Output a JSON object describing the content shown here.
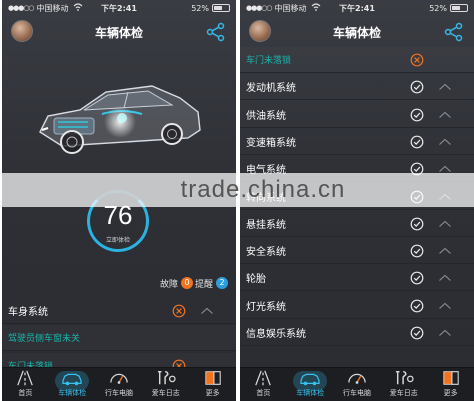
{
  "status": {
    "signal": "●●●○○",
    "carrier": "中国移动",
    "time": "下午2:41",
    "battery": "52%"
  },
  "header": {
    "title": "车辆体检"
  },
  "left": {
    "score": "76",
    "score_caption": "立即体检",
    "legend": {
      "fault_label": "故障",
      "fault_count": "0",
      "remind_label": "提醒",
      "remind_count": "2"
    },
    "rows": [
      {
        "label": "车身系统",
        "status": "error",
        "expanded": true
      },
      {
        "label": "驾驶员侧车窗未关",
        "status": "",
        "sub": true
      },
      {
        "label": "车门未落锁",
        "status": "error",
        "sub": true
      }
    ]
  },
  "right": {
    "rows": [
      {
        "label": "车门未落锁",
        "status": "error",
        "sub": true
      },
      {
        "label": "发动机系统",
        "status": "ok"
      },
      {
        "label": "供油系统",
        "status": "ok"
      },
      {
        "label": "变速箱系统",
        "status": "ok"
      },
      {
        "label": "电气系统",
        "status": "ok"
      },
      {
        "label": "转向系统",
        "status": "ok"
      },
      {
        "label": "悬挂系统",
        "status": "ok"
      },
      {
        "label": "安全系统",
        "status": "ok"
      },
      {
        "label": "轮胎",
        "status": "ok"
      },
      {
        "label": "灯光系统",
        "status": "ok"
      },
      {
        "label": "信息娱乐系统",
        "status": "ok"
      }
    ]
  },
  "tabs": [
    {
      "label": "首页",
      "icon": "road-icon"
    },
    {
      "label": "车辆体检",
      "icon": "car-icon",
      "active": true
    },
    {
      "label": "行车电脑",
      "icon": "speedometer-icon"
    },
    {
      "label": "爱车日志",
      "icon": "tools-icon"
    },
    {
      "label": "更多",
      "icon": "book-icon"
    }
  ],
  "watermark": "trade.china.cn",
  "colors": {
    "accent": "#2bb2e0",
    "error": "#f0731f",
    "teal_text": "#19b6ad",
    "background": "#2e3036"
  }
}
